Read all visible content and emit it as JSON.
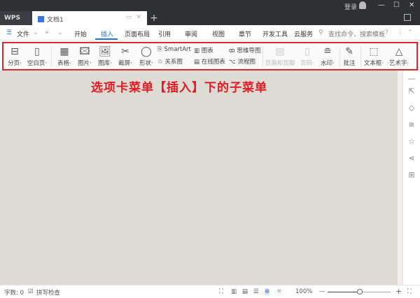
{
  "titlebar": {
    "app": "WPS",
    "doc_tab": "文档1",
    "login": "登录",
    "new_tab": "+",
    "minimize": "—",
    "maximize": "☐",
    "close": "✕"
  },
  "menu": {
    "file": "文件",
    "items": [
      "开始",
      "插入",
      "页面布局",
      "引用",
      "审阅",
      "视图",
      "章节",
      "开发工具",
      "云服务"
    ],
    "active": "插入",
    "search_placeholder": "查找命令、搜索模板",
    "help": "?"
  },
  "ribbon": {
    "buttons": [
      {
        "label": "分页·",
        "icon": "page-break-icon"
      },
      {
        "label": "空白页·",
        "icon": "blank-page-icon"
      },
      {
        "label": "表格·",
        "icon": "table-icon"
      },
      {
        "label": "图片·",
        "icon": "picture-icon"
      },
      {
        "label": "图库·",
        "icon": "gallery-icon"
      },
      {
        "label": "截屏·",
        "icon": "screenshot-icon"
      },
      {
        "label": "形状·",
        "icon": "shape-icon"
      }
    ],
    "small": [
      {
        "label": "SmartArt"
      },
      {
        "label": "关系图"
      },
      {
        "label": "图表"
      },
      {
        "label": "在线图表"
      },
      {
        "label": "思维导图"
      },
      {
        "label": "流程图"
      }
    ],
    "buttons2": [
      {
        "label": "页眉和页脚",
        "disabled": true
      },
      {
        "label": "页码·",
        "disabled": true
      },
      {
        "label": "水印·"
      },
      {
        "label": "批注"
      },
      {
        "label": "文本框·"
      },
      {
        "label": "艺术字·"
      }
    ]
  },
  "annotation": "选项卡菜单【插入】下的子菜单",
  "status": {
    "word_count": "字数: 0",
    "spell_check": "拼写检查",
    "zoom": "100%",
    "zoom_out": "—",
    "zoom_in": "+"
  },
  "colors": {
    "accent": "#2b74d4",
    "annotation": "#e31b23",
    "canvas": "#dddbd4"
  }
}
